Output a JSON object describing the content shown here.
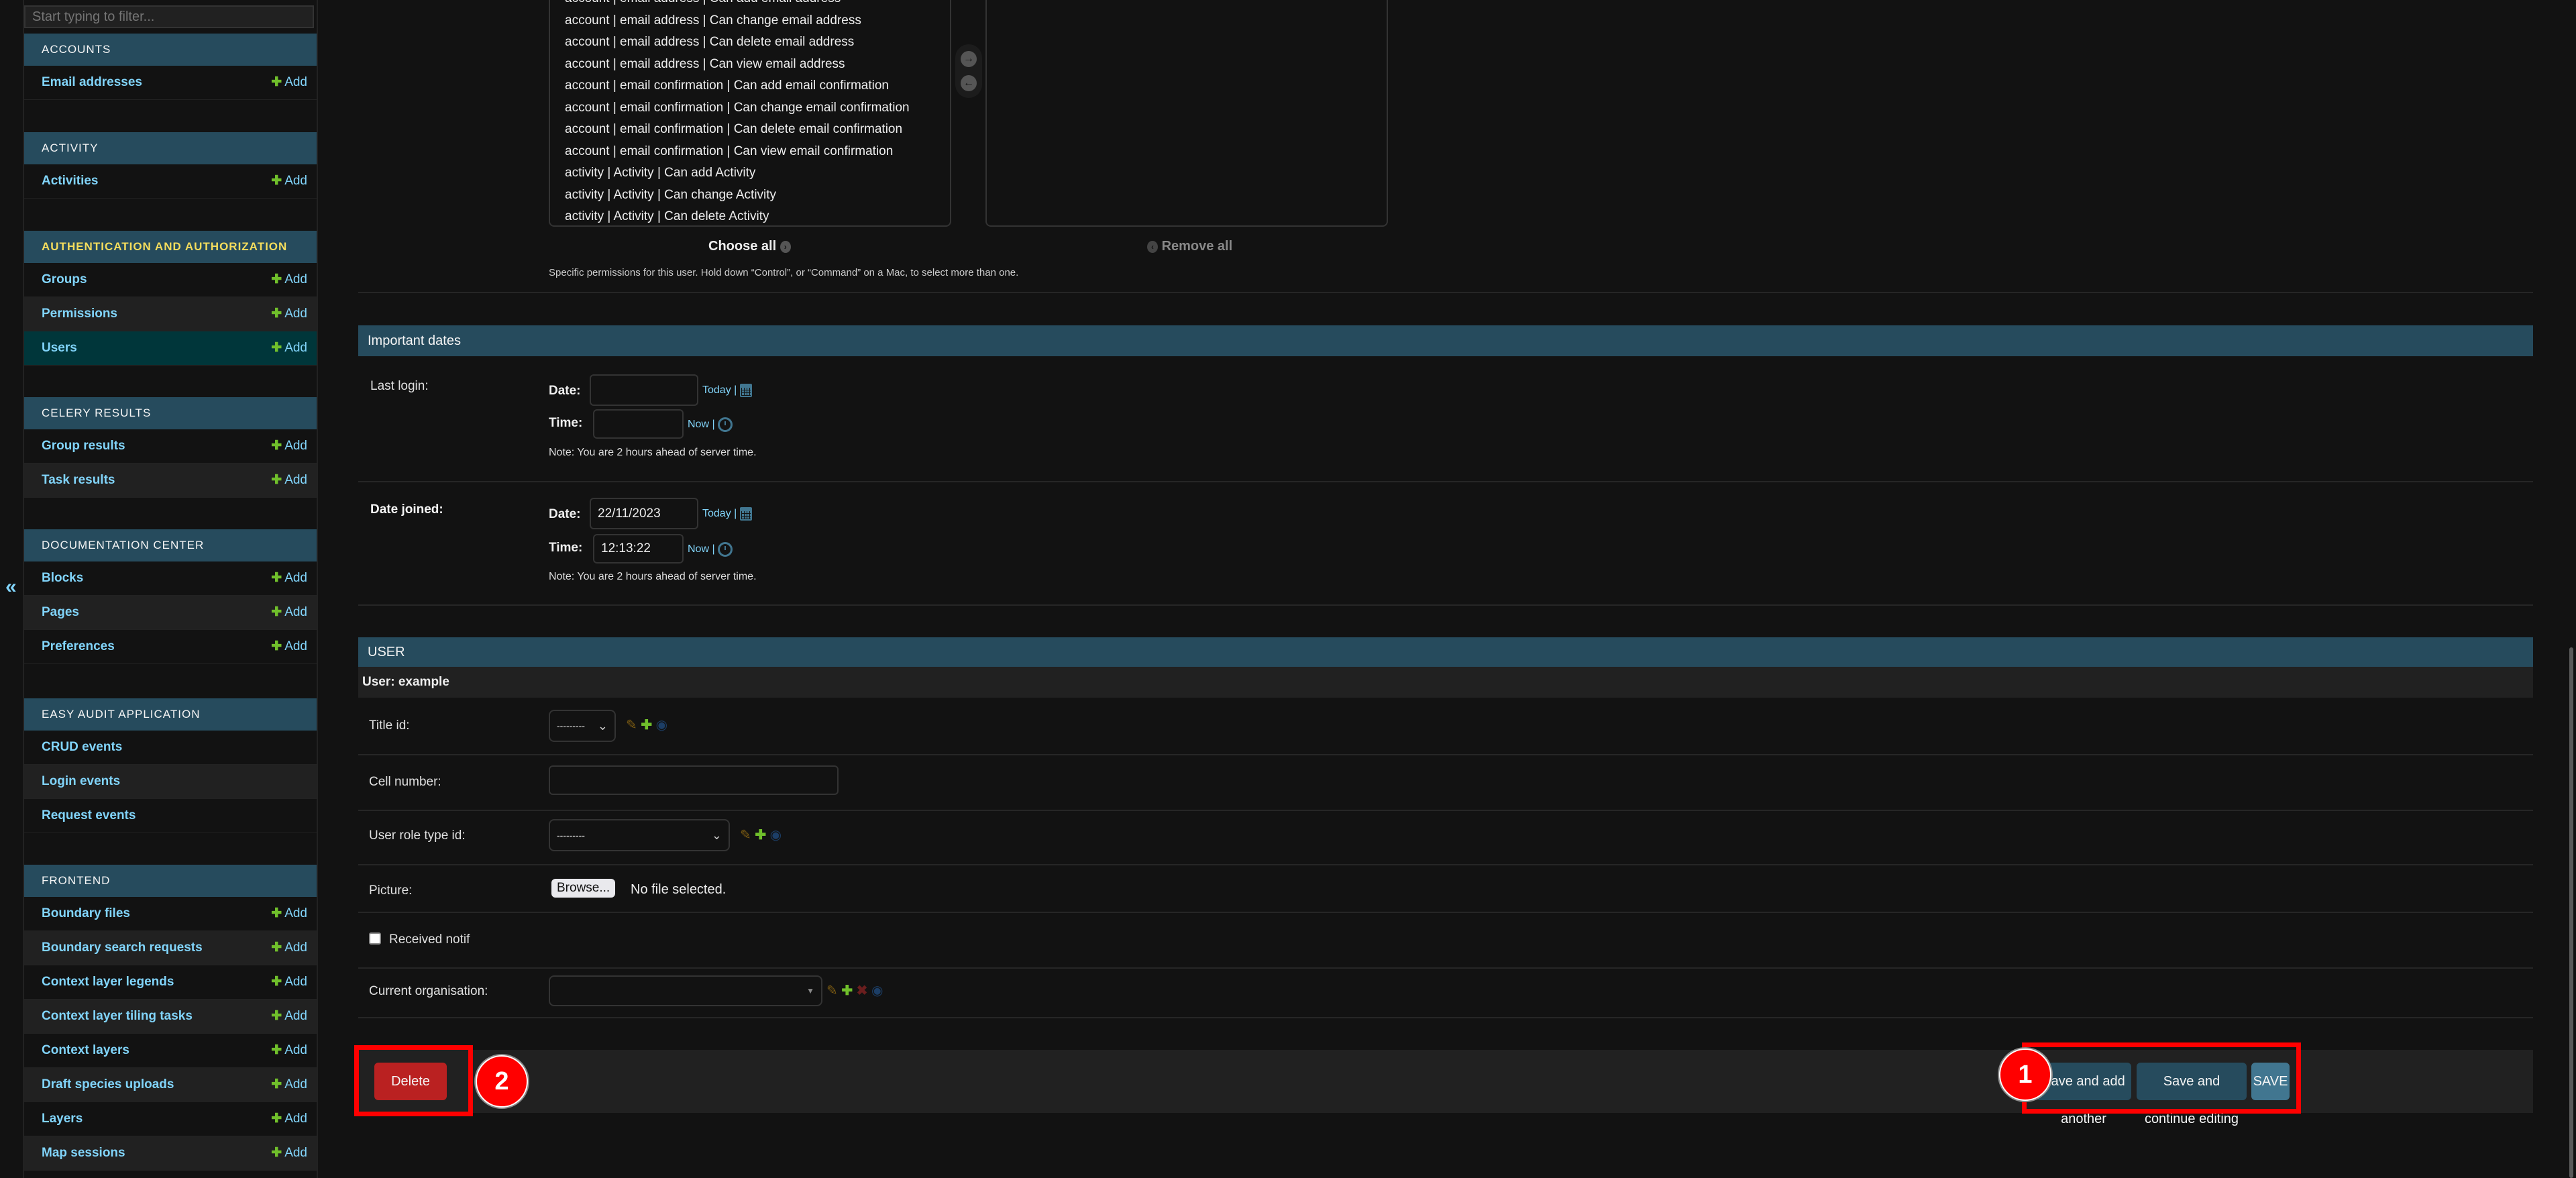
{
  "sidebar": {
    "filter_placeholder": "Start typing to filter...",
    "collapse_label": "«",
    "add_label": "Add",
    "sections": [
      {
        "caption": "Accounts",
        "items": [
          {
            "label": "Email addresses",
            "add": true
          }
        ]
      },
      {
        "caption": "Activity",
        "items": [
          {
            "label": "Activities",
            "add": true
          }
        ]
      },
      {
        "caption": "Authentication and Authorization",
        "active": true,
        "items": [
          {
            "label": "Groups",
            "add": true
          },
          {
            "label": "Permissions",
            "add": true
          },
          {
            "label": "Users",
            "add": true,
            "current": true
          }
        ]
      },
      {
        "caption": "Celery Results",
        "items": [
          {
            "label": "Group results",
            "add": true
          },
          {
            "label": "Task results",
            "add": true
          }
        ]
      },
      {
        "caption": "Documentation Center",
        "items": [
          {
            "label": "Blocks",
            "add": true
          },
          {
            "label": "Pages",
            "add": true
          },
          {
            "label": "Preferences",
            "add": true
          }
        ]
      },
      {
        "caption": "Easy Audit Application",
        "items": [
          {
            "label": "CRUD events",
            "add": false
          },
          {
            "label": "Login events",
            "add": false
          },
          {
            "label": "Request events",
            "add": false
          }
        ]
      },
      {
        "caption": "Frontend",
        "items": [
          {
            "label": "Boundary files",
            "add": true
          },
          {
            "label": "Boundary search requests",
            "add": true
          },
          {
            "label": "Context layer legends",
            "add": true
          },
          {
            "label": "Context layer tiling tasks",
            "add": true
          },
          {
            "label": "Context layers",
            "add": true
          },
          {
            "label": "Draft species uploads",
            "add": true
          },
          {
            "label": "Layers",
            "add": true
          },
          {
            "label": "Map sessions",
            "add": true
          }
        ]
      }
    ]
  },
  "permissions": {
    "available_options": [
      "account | email address | Can add email address",
      "account | email address | Can change email address",
      "account | email address | Can delete email address",
      "account | email address | Can view email address",
      "account | email confirmation | Can add email confirmation",
      "account | email confirmation | Can change email confirmation",
      "account | email confirmation | Can delete email confirmation",
      "account | email confirmation | Can view email confirmation",
      "activity | Activity | Can add Activity",
      "activity | Activity | Can change Activity",
      "activity | Activity | Can delete Activity"
    ],
    "chosen_options": [],
    "choose_all_label": "Choose all",
    "remove_all_label": "Remove all",
    "help_text": "Specific permissions for this user. Hold down “Control”, or “Command” on a Mac, to select more than one."
  },
  "important_dates": {
    "title": "Important dates",
    "last_login": {
      "label": "Last login:",
      "date_label": "Date:",
      "date_value": "",
      "time_label": "Time:",
      "time_value": "",
      "today_label": "Today |",
      "now_label": "Now |",
      "note": "Note: You are 2 hours ahead of server time."
    },
    "date_joined": {
      "label": "Date joined:",
      "date_label": "Date:",
      "date_value": "22/11/2023",
      "time_label": "Time:",
      "time_value": "12:13:22",
      "today_label": "Today |",
      "now_label": "Now |",
      "note": "Note: You are 2 hours ahead of server time."
    }
  },
  "user_inline": {
    "title": "USER",
    "subtitle": "User: example",
    "fields": {
      "title_id": {
        "label": "Title id:",
        "value": "---------"
      },
      "cell_number": {
        "label": "Cell number:",
        "value": ""
      },
      "user_role_type_id": {
        "label": "User role type id:",
        "value": "---------"
      },
      "picture": {
        "label": "Picture:",
        "browse_label": "Browse...",
        "file_status": "No file selected."
      },
      "received_notif": {
        "label": "Received notif",
        "checked": false
      },
      "current_organisation": {
        "label": "Current organisation:",
        "value": ""
      }
    }
  },
  "submit_row": {
    "delete_label": "Delete",
    "save_add_another_label": "Save and add another",
    "save_continue_label": "Save and continue editing",
    "save_label": "SAVE"
  },
  "annotations": [
    {
      "number": "1",
      "target": "save buttons group"
    },
    {
      "number": "2",
      "target": "delete button"
    }
  ],
  "colors": {
    "header_bg": "#264b5d",
    "link": "#81d4fa",
    "add_green": "#70bf2b",
    "delete_red": "#ba2121",
    "save_blue": "#417690",
    "active_caption": "#f5dd5d",
    "annotation_red": "#ff0000"
  }
}
